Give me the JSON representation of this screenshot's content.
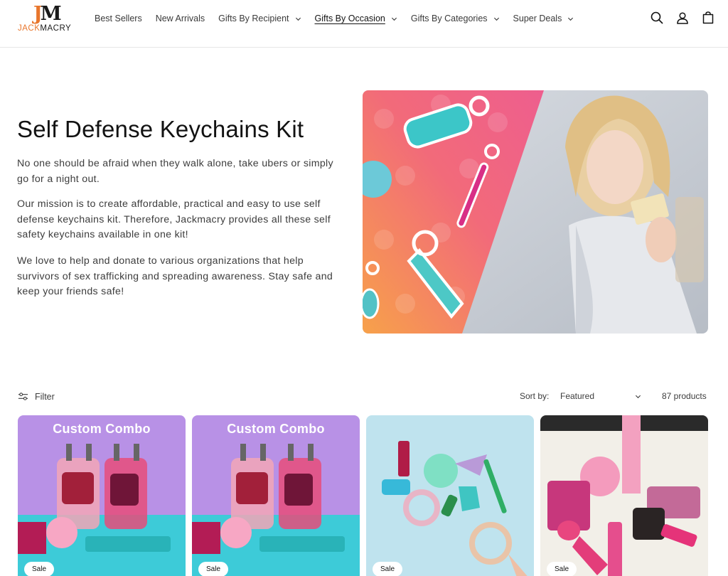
{
  "brand": {
    "mark_j": "J",
    "mark_m": "M",
    "name_jack": "JACK",
    "name_macry": "MACRY",
    "accent": "#e8762c"
  },
  "nav": {
    "items": [
      {
        "label": "Best Sellers",
        "dropdown": false
      },
      {
        "label": "New Arrivals",
        "dropdown": false
      },
      {
        "label": "Gifts By Recipient",
        "dropdown": true
      },
      {
        "label": "Gifts By Occasion",
        "dropdown": true,
        "active": true
      },
      {
        "label": "Gifts By Categories",
        "dropdown": true
      },
      {
        "label": "Super Deals",
        "dropdown": true
      }
    ]
  },
  "header_icons": [
    "search-icon",
    "account-icon",
    "cart-icon"
  ],
  "hero": {
    "title": "Self Defense Keychains Kit",
    "paragraphs": [
      "No one should be afraid when they walk alone, take ubers or simply go for a night out.",
      "Our mission is to create affordable, practical and easy to use self defense keychains kit. Therefore, Jackmacry provides all these self safety keychains available in one kit!",
      "We love to help and donate to various organizations that help survivors of sex trafficking and spreading awareness. Stay safe and keep your friends safe!"
    ]
  },
  "toolbar": {
    "filter_label": "Filter",
    "sort_label": "Sort by:",
    "sort_value": "Featured",
    "product_count": "87 products"
  },
  "products": [
    {
      "overlay_title": "Custom Combo",
      "badge": "Sale"
    },
    {
      "overlay_title": "Custom Combo",
      "badge": "Sale"
    },
    {
      "overlay_title": "",
      "badge": "Sale"
    },
    {
      "overlay_title": "",
      "badge": "Sale"
    }
  ]
}
